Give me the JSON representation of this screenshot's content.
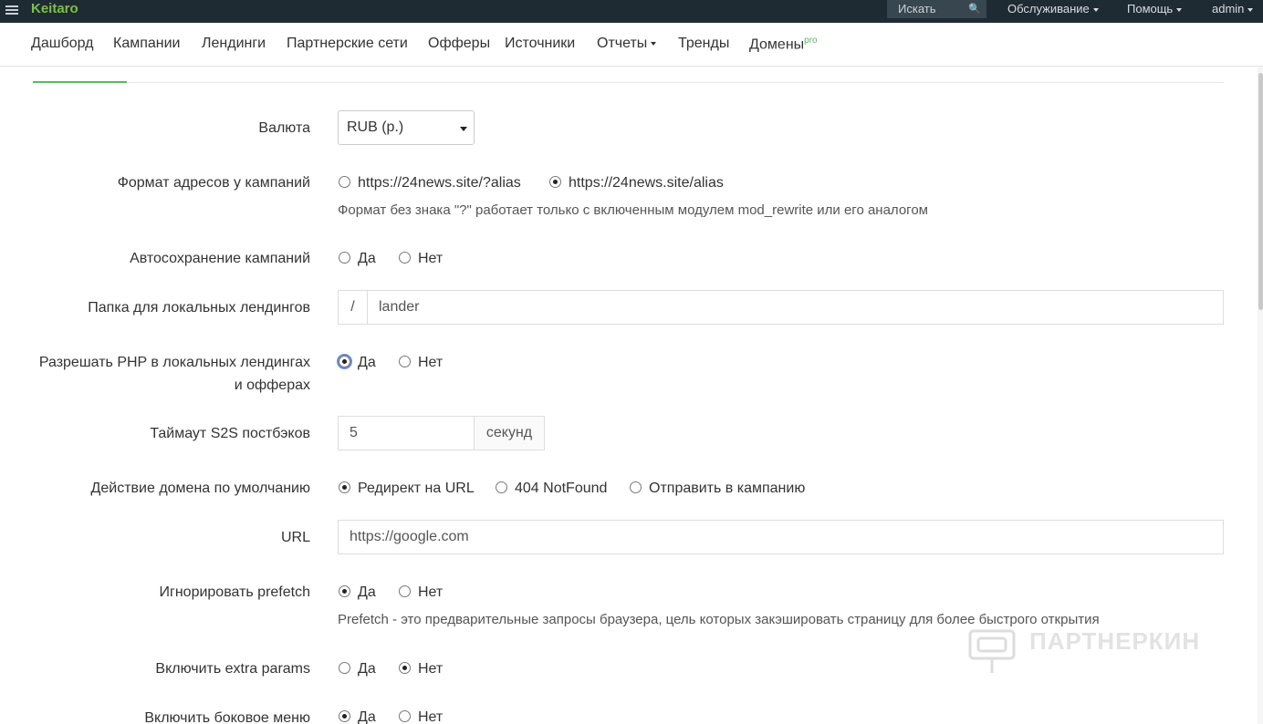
{
  "topbar": {
    "brand": "Keitaro",
    "search_placeholder": "Искать",
    "menu": [
      "Обслуживание",
      "Помощь",
      "admin"
    ]
  },
  "nav": {
    "items": [
      "Дашборд",
      "Кампании",
      "Лендинги",
      "Партнерские сети",
      "Офферы",
      "Источники",
      "Отчеты",
      "Тренды",
      "Домены"
    ],
    "pro_badge": "pro"
  },
  "form": {
    "currency": {
      "label": "Валюта",
      "value": "RUB (р.)"
    },
    "url_format": {
      "label": "Формат адресов у кампаний",
      "options": [
        "https://24news.site/?alias",
        "https://24news.site/alias"
      ],
      "selected": 1,
      "help": "Формат без знака \"?\" работает только с включенным модулем mod_rewrite или его аналогом"
    },
    "autosave": {
      "label": "Автосохранение кампаний",
      "options": [
        "Да",
        "Нет"
      ],
      "selected": null
    },
    "landers_folder": {
      "label": "Папка для локальных лендингов",
      "prefix": "/",
      "value": "lander"
    },
    "allow_php": {
      "label_line1": "Разрешать PHP в локальных лендингах",
      "label_line2": "и офферах",
      "options": [
        "Да",
        "Нет"
      ],
      "selected": 0
    },
    "s2s_timeout": {
      "label": "Таймаут S2S постбэков",
      "value": "5",
      "suffix": "секунд"
    },
    "domain_action": {
      "label": "Действие домена по умолчанию",
      "options": [
        "Редирект на URL",
        "404 NotFound",
        "Отправить в кампанию"
      ],
      "selected": 0
    },
    "url": {
      "label": "URL",
      "value": "https://google.com"
    },
    "ignore_prefetch": {
      "label": "Игнорировать prefetch",
      "options": [
        "Да",
        "Нет"
      ],
      "selected": 0,
      "help": "Prefetch - это предварительные запросы браузера, цель которых закэшировать страницу для более быстрого открытия"
    },
    "extra_params": {
      "label": "Включить extra params",
      "options": [
        "Да",
        "Нет"
      ],
      "selected": 1
    },
    "side_menu": {
      "label": "Включить боковое меню",
      "options": [
        "Да",
        "Нет"
      ],
      "selected": 0
    }
  },
  "watermark": {
    "text": "ПАРТНЕРКИН"
  },
  "colors": {
    "topbar": "#1f2b33",
    "brand": "#7bc143",
    "accent": "#5cb85c"
  }
}
